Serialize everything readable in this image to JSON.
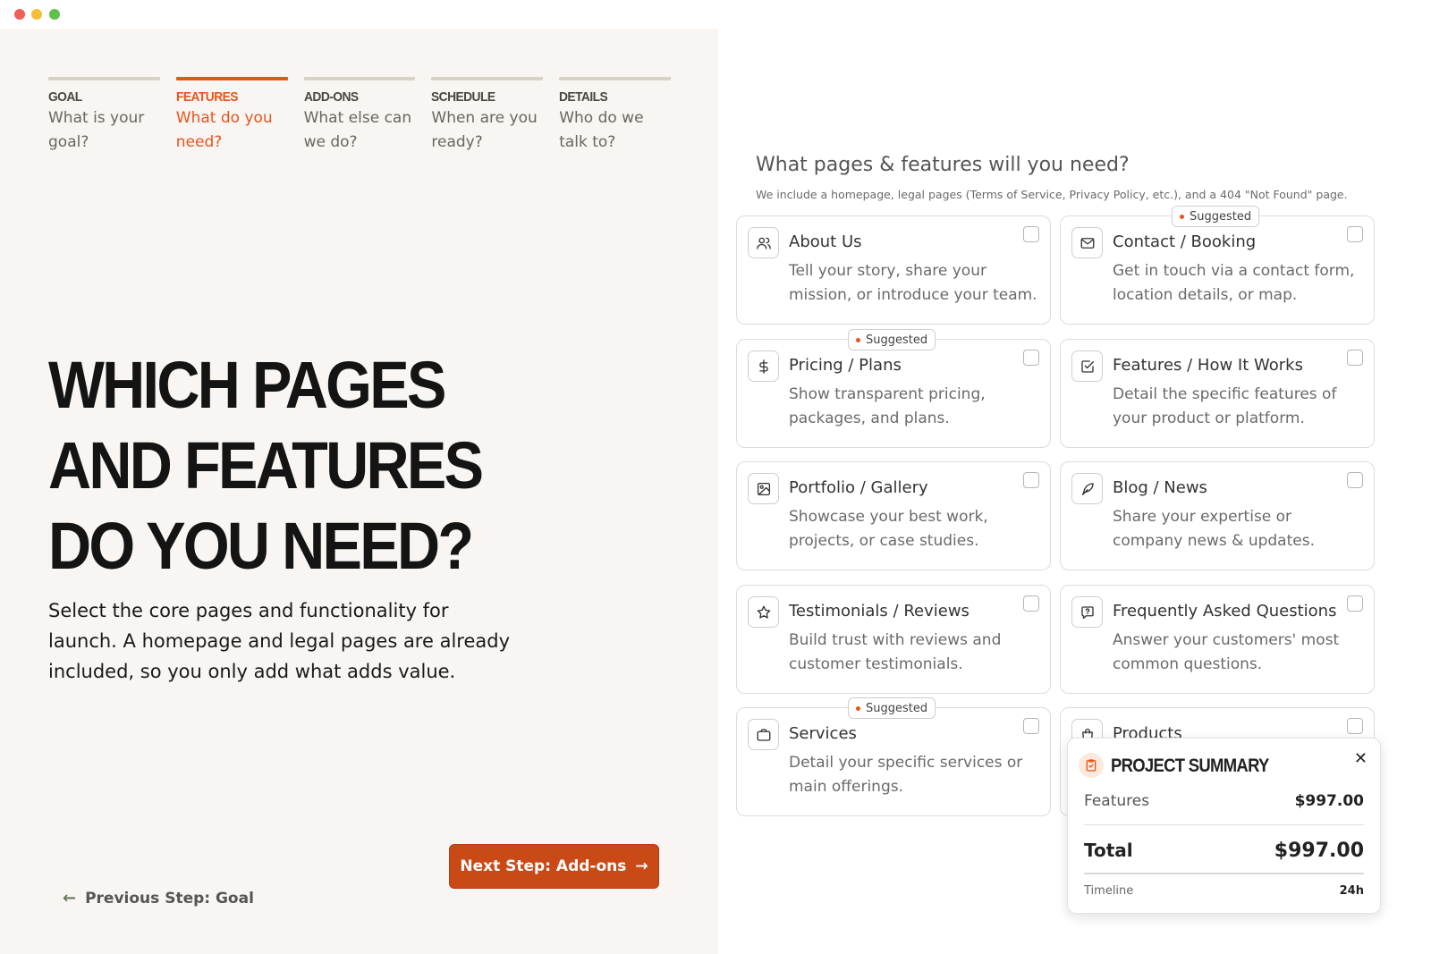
{
  "steps": [
    {
      "name": "GOAL",
      "question": "What is your goal?"
    },
    {
      "name": "FEATURES",
      "question": "What do you need?"
    },
    {
      "name": "ADD-ONS",
      "question": "What else can we do?"
    },
    {
      "name": "SCHEDULE",
      "question": "When are you ready?"
    },
    {
      "name": "DETAILS",
      "question": "Who do we talk to?"
    }
  ],
  "active_step": "FEATURES",
  "headline": "WHICH PAGES AND FEATURES DO YOU NEED?",
  "intro": "Select the core pages and functionality for launch. A homepage and legal pages are already included, so you only add what adds value.",
  "nav": {
    "prev_label": "Previous Step: Goal",
    "next_label": "Next Step: Add-ons"
  },
  "right": {
    "title": "What pages & features will you need?",
    "subtitle": "We include a homepage, legal pages (Terms of Service, Privacy Policy, etc.), and a 404 \"Not Found\" page."
  },
  "badge_label": "Suggested",
  "cards": [
    {
      "title": "About Us",
      "desc": "Tell your story, share your mission, or introduce your team.",
      "icon": "users-icon",
      "suggested": false,
      "checked": false
    },
    {
      "title": "Contact / Booking",
      "desc": "Get in touch via a contact form, location details, or map.",
      "icon": "mail-icon",
      "suggested": true,
      "checked": false
    },
    {
      "title": "Pricing / Plans",
      "desc": "Show transparent pricing, packages, and plans.",
      "icon": "dollar-icon",
      "suggested": true,
      "checked": false
    },
    {
      "title": "Features / How It Works",
      "desc": "Detail the specific features of your product or platform.",
      "icon": "checkbox-icon",
      "suggested": false,
      "checked": false
    },
    {
      "title": "Portfolio / Gallery",
      "desc": "Showcase your best work, projects, or case studies.",
      "icon": "image-icon",
      "suggested": false,
      "checked": false
    },
    {
      "title": "Blog / News",
      "desc": "Share your expertise or company news & updates.",
      "icon": "feather-icon",
      "suggested": false,
      "checked": false
    },
    {
      "title": "Testimonials / Reviews",
      "desc": "Build trust with reviews and customer testimonials.",
      "icon": "star-icon",
      "suggested": false,
      "checked": false
    },
    {
      "title": "Frequently Asked Questions",
      "desc": "Answer your customers' most common questions.",
      "icon": "question-bubble-icon",
      "suggested": false,
      "checked": false
    },
    {
      "title": "Services",
      "desc": "Detail your specific services or main offerings.",
      "icon": "briefcase-icon",
      "suggested": true,
      "checked": false
    },
    {
      "title": "Products",
      "desc": "",
      "icon": "shopping-bag-icon",
      "suggested": false,
      "checked": false
    }
  ],
  "summary": {
    "title": "PROJECT SUMMARY",
    "features_label": "Features",
    "features_value": "$997.00",
    "total_label": "Total",
    "total_value": "$997.00",
    "timeline_label": "Timeline",
    "timeline_value": "24h"
  },
  "colors": {
    "accent": "#e8541e",
    "button": "#c94a17",
    "left_bg": "#f8f5f2"
  }
}
